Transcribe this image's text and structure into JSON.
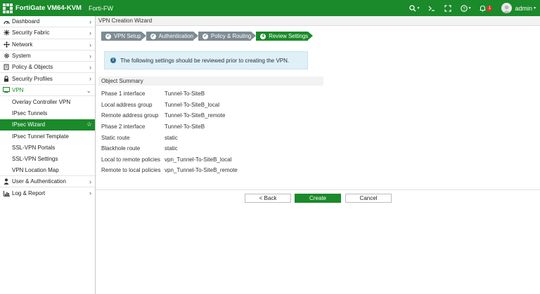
{
  "header": {
    "app_title": "FortiGate VM64-KVM",
    "device": "Forti-FW",
    "notification_count": "1",
    "user": "admin"
  },
  "sidebar": {
    "items": [
      {
        "label": "Dashboard",
        "icon": "dashboard-icon"
      },
      {
        "label": "Security Fabric",
        "icon": "fabric-icon"
      },
      {
        "label": "Network",
        "icon": "network-icon"
      },
      {
        "label": "System",
        "icon": "gear-icon"
      },
      {
        "label": "Policy & Objects",
        "icon": "policy-icon"
      },
      {
        "label": "Security Profiles",
        "icon": "lock-icon"
      },
      {
        "label": "VPN",
        "icon": "vpn-icon"
      },
      {
        "label": "Overlay Controller VPN"
      },
      {
        "label": "IPsec Tunnels"
      },
      {
        "label": "IPsec Wizard"
      },
      {
        "label": "IPsec Tunnel Template"
      },
      {
        "label": "SSL-VPN Portals"
      },
      {
        "label": "SSL-VPN Settings"
      },
      {
        "label": "VPN Location Map"
      },
      {
        "label": "User & Authentication",
        "icon": "user-icon"
      },
      {
        "label": "Log & Report",
        "icon": "chart-icon"
      }
    ]
  },
  "main": {
    "panel_title": "VPN Creation Wizard",
    "steps": [
      {
        "label": "VPN Setup",
        "marker": "✔"
      },
      {
        "label": "Authentication",
        "marker": "✔"
      },
      {
        "label": "Policy & Routing",
        "marker": "✔"
      },
      {
        "label": "Review Settings",
        "marker": "4"
      }
    ],
    "info_text": "The following settings should be reviewed prior to creating the VPN.",
    "summary_title": "Object Summary",
    "summary": [
      {
        "key": "Phase 1 interface",
        "value": "Tunnel-To-SiteB"
      },
      {
        "key": "Local address group",
        "value": "Tunnel-To-SiteB_local"
      },
      {
        "key": "Remote address group",
        "value": "Tunnel-To-SiteB_remote"
      },
      {
        "key": "Phase 2 interface",
        "value": "Tunnel-To-SiteB"
      },
      {
        "key": "Static route",
        "value": "static"
      },
      {
        "key": "Blackhole route",
        "value": "static"
      },
      {
        "key": "Local to remote policies",
        "value": "vpn_Tunnel-To-SiteB_local"
      },
      {
        "key": "Remote to local policies",
        "value": "vpn_Tunnel-To-SiteB_remote"
      }
    ],
    "buttons": {
      "back": "< Back",
      "create": "Create",
      "cancel": "Cancel"
    }
  },
  "colors": {
    "brand_green": "#1a8a2a",
    "step_gray": "#7d8b93",
    "info_bg": "#dff0f7"
  }
}
